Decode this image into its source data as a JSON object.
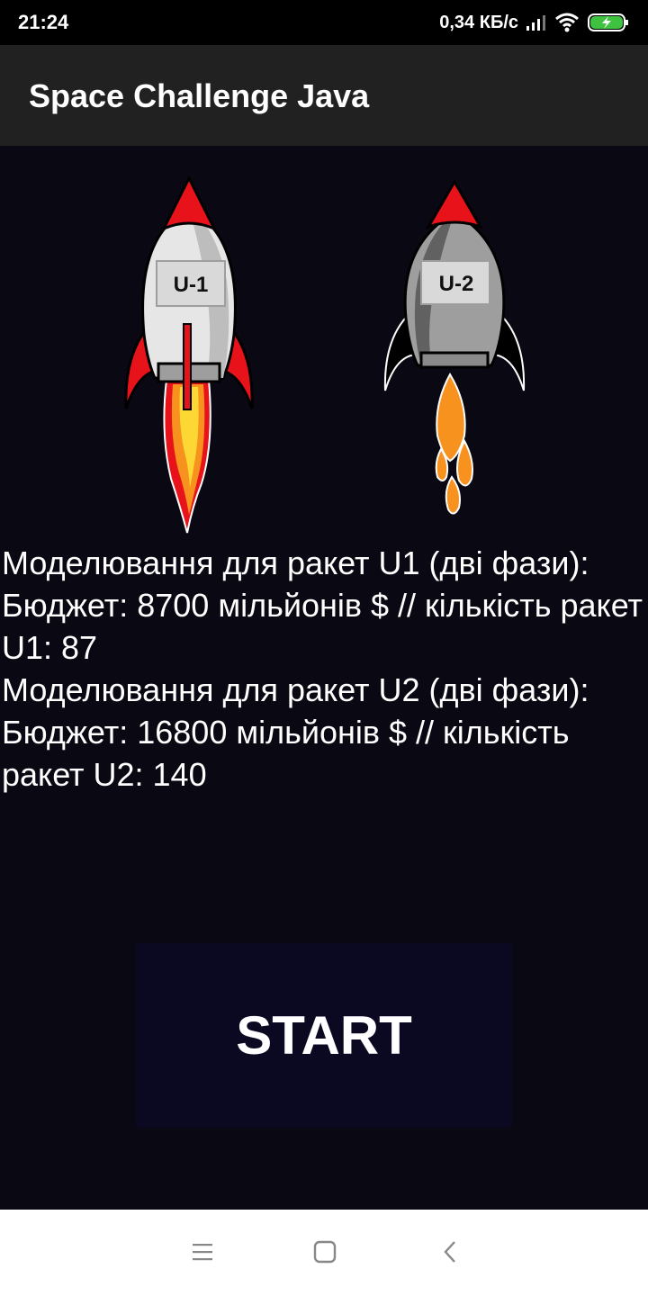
{
  "status": {
    "time": "21:24",
    "net_speed": "0,34 КБ/с"
  },
  "app": {
    "title": "Space Challenge Java"
  },
  "rockets": [
    {
      "label": "U-1"
    },
    {
      "label": "U-2"
    }
  ],
  "results": [
    "Моделювання для ракет U1 (дві фази):",
    "Бюджет: 8700 мільйонів $ // кількість ракет U1: 87",
    "Моделювання для ракет U2 (дві фази):",
    "Бюджет: 16800 мільйонів $ // кількість ракет U2: 140"
  ],
  "start_label": "START",
  "colors": {
    "background": "#0a0812",
    "app_bar": "#212121",
    "button": "#0b0922",
    "rocket_red": "#e8121a",
    "flame_orange": "#f7921e"
  },
  "nav": {
    "icons": [
      "menu-icon",
      "home-icon",
      "back-icon"
    ]
  }
}
